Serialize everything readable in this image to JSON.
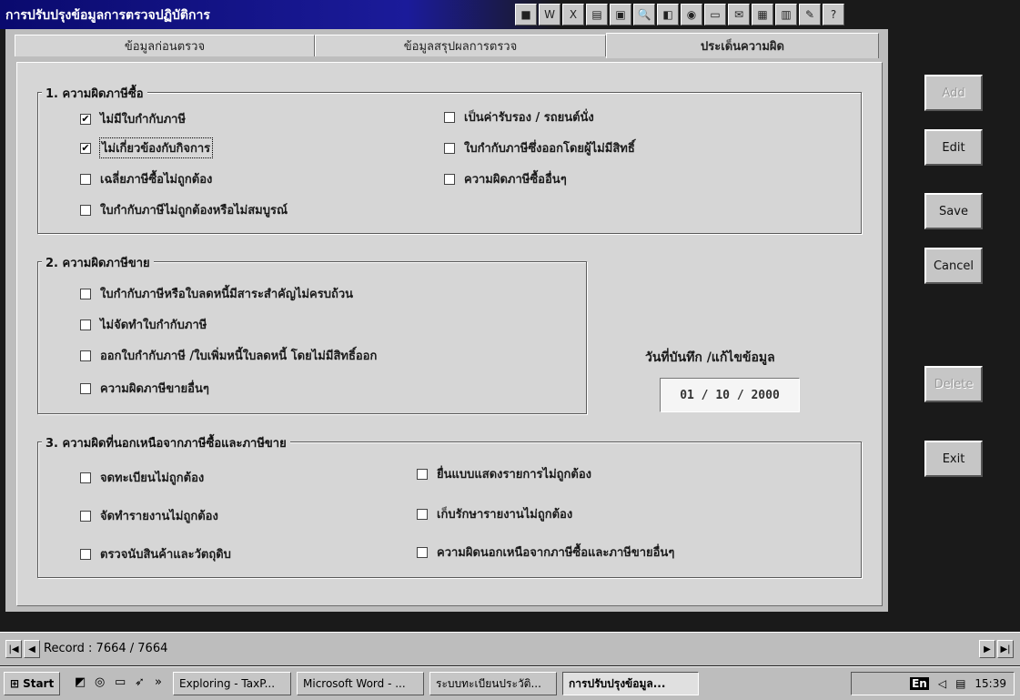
{
  "window": {
    "title": "การปรับปรุงข้อมูลการตรวจปฏิบัติการ"
  },
  "toolbar": {
    "icons": [
      "app-icon",
      "word-icon",
      "excel-icon",
      "access-icon",
      "powerpoint-icon",
      "search-icon",
      "preview-icon",
      "paint-icon",
      "folder-icon",
      "mail-icon",
      "chart-icon",
      "calendar-icon",
      "tools-icon",
      "help-icon"
    ]
  },
  "tabs": [
    {
      "label": "ข้อมูลก่อนตรวจ"
    },
    {
      "label": "ข้อมูลสรุปผลการตรวจ"
    },
    {
      "label": "ประเด็นความผิด"
    }
  ],
  "group1": {
    "title": "1. ความผิดภาษีซื้อ",
    "items": [
      {
        "label": "ไม่มีใบกำกับภาษี",
        "checked": true
      },
      {
        "label": "ไม่เกี่ยวข้องกับกิจการ",
        "checked": true
      },
      {
        "label": "เฉลี่ยภาษีซื้อไม่ถูกต้อง",
        "checked": false
      },
      {
        "label": "ใบกำกับภาษีไม่ถูกต้องหรือไม่สมบูรณ์",
        "checked": false
      },
      {
        "label": "เป็นค่ารับรอง / รถยนต์นั่ง",
        "checked": false
      },
      {
        "label": "ใบกำกับภาษีซึ่งออกโดยผู้ไม่มีสิทธิ์",
        "checked": false
      },
      {
        "label": "ความผิดภาษีซื้ออื่นๆ",
        "checked": false
      }
    ]
  },
  "group2": {
    "title": "2. ความผิดภาษีขาย",
    "items": [
      {
        "label": "ใบกำกับภาษีหรือใบลดหนี้มีสาระสำคัญไม่ครบถ้วน",
        "checked": false
      },
      {
        "label": "ไม่จัดทำใบกำกับภาษี",
        "checked": false
      },
      {
        "label": "ออกใบกำกับภาษี /ใบเพิ่มหนี้ใบลดหนี้ โดยไม่มีสิทธิ์ออก",
        "checked": false
      },
      {
        "label": "ความผิดภาษีขายอื่นๆ",
        "checked": false
      }
    ]
  },
  "group3": {
    "title": "3. ความผิดที่นอกเหนือจากภาษีซื้อและภาษีขาย",
    "items": [
      {
        "label": "จดทะเบียนไม่ถูกต้อง",
        "checked": false
      },
      {
        "label": "จัดทำรายงานไม่ถูกต้อง",
        "checked": false
      },
      {
        "label": "ตรวจนับสินค้าและวัตถุดิบ",
        "checked": false
      },
      {
        "label": "ยื่นแบบแสดงรายการไม่ถูกต้อง",
        "checked": false
      },
      {
        "label": "เก็บรักษารายงานไม่ถูกต้อง",
        "checked": false
      },
      {
        "label": "ความผิดนอกเหนือจากภาษีซื้อและภาษีขายอื่นๆ",
        "checked": false
      }
    ]
  },
  "date": {
    "label": "วันที่บันทึก /แก้ไขข้อมูล",
    "value": "01 / 10 / 2000"
  },
  "buttons": {
    "add": "Add",
    "edit": "Edit",
    "save": "Save",
    "cancel": "Cancel",
    "delete": "Delete",
    "exit": "Exit"
  },
  "record": {
    "text": "Record : 7664 / 7664"
  },
  "taskbar": {
    "start": "Start",
    "tasks": [
      {
        "label": "Exploring - TaxP..."
      },
      {
        "label": "Microsoft Word - ..."
      },
      {
        "label": "ระบบทะเบียนประวัติ..."
      },
      {
        "label": "การปรับปรุงข้อมูล..."
      }
    ],
    "lang": "En",
    "clock": "15:39"
  }
}
